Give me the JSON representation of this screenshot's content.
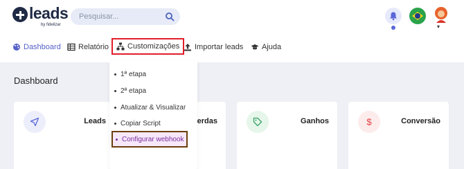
{
  "brand": {
    "name": "leads",
    "tagline": "by fidelizar"
  },
  "search": {
    "placeholder": "Pesquisar...",
    "value": ""
  },
  "nav": {
    "items": [
      {
        "label": "Dashboard",
        "icon": "palette-icon"
      },
      {
        "label": "Relatório",
        "icon": "table-icon"
      },
      {
        "label": "Customizações",
        "icon": "sitemap-icon"
      },
      {
        "label": "Importar leads",
        "icon": "upload-icon"
      },
      {
        "label": "Ajuda",
        "icon": "graduation-cap-icon"
      }
    ]
  },
  "dropdown": {
    "items": [
      {
        "label": "1ª etapa"
      },
      {
        "label": "2ª etapa"
      },
      {
        "label": "Atualizar & Visualizar"
      },
      {
        "label": "Copiar Script"
      },
      {
        "label": "Configurar webhook"
      }
    ]
  },
  "main": {
    "title": "Dashboard",
    "cards": [
      {
        "label": "Leads",
        "icon": "send-icon",
        "color": "#5a67d8"
      },
      {
        "label": "Perdas",
        "icon": "x-icon",
        "color": "#e53e3e"
      },
      {
        "label": "Ganhos",
        "icon": "tag-icon",
        "color": "#38a169"
      },
      {
        "label": "Conversão",
        "icon": "dollar-icon",
        "color": "#e53e3e"
      }
    ]
  },
  "colors": {
    "accent": "#5560c8",
    "highlight_red": "#e11d2a",
    "highlight_brown": "#6b3f0a"
  }
}
